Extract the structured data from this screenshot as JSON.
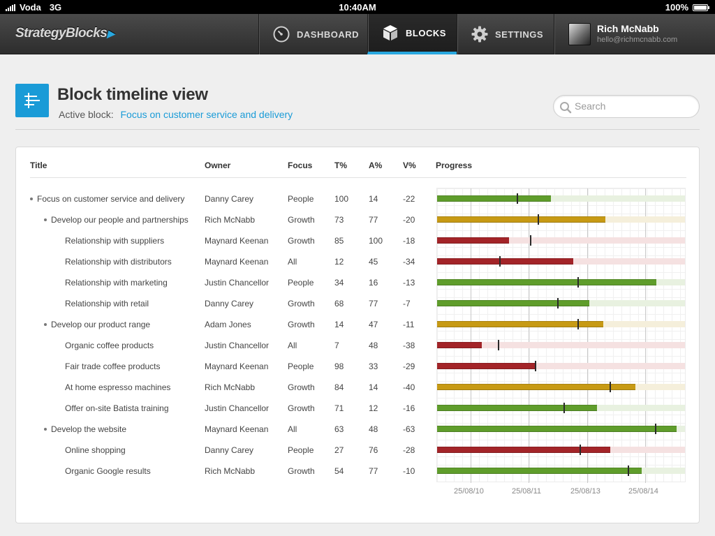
{
  "status": {
    "carrier": "Voda",
    "network": "3G",
    "time": "10:40AM",
    "battery": "100%"
  },
  "nav": {
    "logo": "StrategyBlocks",
    "items": [
      {
        "label": "DASHBOARD",
        "icon": "gauge-icon"
      },
      {
        "label": "BLOCKS",
        "icon": "cube-icon"
      },
      {
        "label": "SETTINGS",
        "icon": "gear-icon"
      }
    ],
    "active": "BLOCKS",
    "user": {
      "name": "Rich McNabb",
      "email": "hello@richmcnabb.com"
    }
  },
  "header": {
    "title": "Block timeline view",
    "active_label": "Active block:",
    "active_value": "Focus on customer service and delivery",
    "search_placeholder": "Search"
  },
  "table": {
    "columns": [
      "Title",
      "Owner",
      "Focus",
      "T%",
      "A%",
      "V%",
      "Progress"
    ],
    "status_colors": {
      "green": "#5f9d2b",
      "yellow": "#c79a14",
      "red": "#a32428"
    },
    "track_colors": {
      "green": "#e8f1e0",
      "yellow": "#f5efdb",
      "red": "#f5e1e1"
    },
    "rows": [
      {
        "title": "Focus on customer service and delivery",
        "level": 0,
        "owner": "Danny Carey",
        "focus": "People",
        "t": "100",
        "a": "14",
        "v": "-22",
        "status": "green",
        "progress": 0.46,
        "marker": 0.32
      },
      {
        "title": "Develop our people and partnerships",
        "level": 1,
        "owner": "Rich McNabb",
        "focus": "Growth",
        "t": "73",
        "a": "77",
        "v": "-20",
        "status": "yellow",
        "progress": 0.68,
        "marker": 0.405
      },
      {
        "title": "Relationship with suppliers",
        "level": 2,
        "owner": "Maynard Keenan",
        "focus": "Growth",
        "t": "85",
        "a": "100",
        "v": "-18",
        "status": "red",
        "progress": 0.29,
        "marker": 0.375
      },
      {
        "title": "Relationship with distributors",
        "level": 2,
        "owner": "Maynard Keenan",
        "focus": "All",
        "t": "12",
        "a": "45",
        "v": "-34",
        "status": "red",
        "progress": 0.55,
        "marker": 0.25
      },
      {
        "title": "Relationship with marketing",
        "level": 2,
        "owner": "Justin Chancellor",
        "focus": "People",
        "t": "34",
        "a": "16",
        "v": "-13",
        "status": "green",
        "progress": 0.885,
        "marker": 0.565
      },
      {
        "title": "Relationship with retail",
        "level": 2,
        "owner": "Danny Carey",
        "focus": "Growth",
        "t": "68",
        "a": "77",
        "v": "-7",
        "status": "green",
        "progress": 0.615,
        "marker": 0.485
      },
      {
        "title": "Develop our product range",
        "level": 1,
        "owner": "Adam Jones",
        "focus": "Growth",
        "t": "14",
        "a": "47",
        "v": "-11",
        "status": "yellow",
        "progress": 0.67,
        "marker": 0.565
      },
      {
        "title": "Organic coffee products",
        "level": 2,
        "owner": "Justin Chancellor",
        "focus": "All",
        "t": "7",
        "a": "48",
        "v": "-38",
        "status": "red",
        "progress": 0.18,
        "marker": 0.245
      },
      {
        "title": "Fair trade coffee products",
        "level": 2,
        "owner": "Maynard Keenan",
        "focus": "People",
        "t": "98",
        "a": "33",
        "v": "-29",
        "status": "red",
        "progress": 0.395,
        "marker": 0.395
      },
      {
        "title": "At home espresso machines",
        "level": 2,
        "owner": "Rich McNabb",
        "focus": "Growth",
        "t": "84",
        "a": "14",
        "v": "-40",
        "status": "yellow",
        "progress": 0.8,
        "marker": 0.695
      },
      {
        "title": "Offer on-site Batista training",
        "level": 2,
        "owner": "Justin Chancellor",
        "focus": "Growth",
        "t": "71",
        "a": "12",
        "v": "-16",
        "status": "green",
        "progress": 0.645,
        "marker": 0.51
      },
      {
        "title": "Develop the website",
        "level": 1,
        "owner": "Maynard Keenan",
        "focus": "All",
        "t": "63",
        "a": "48",
        "v": "-63",
        "status": "green",
        "progress": 0.965,
        "marker": 0.88
      },
      {
        "title": "Online shopping",
        "level": 2,
        "owner": "Danny Carey",
        "focus": "People",
        "t": "27",
        "a": "76",
        "v": "-28",
        "status": "red",
        "progress": 0.7,
        "marker": 0.575
      },
      {
        "title": "Organic Google results",
        "level": 2,
        "owner": "Rich McNabb",
        "focus": "Growth",
        "t": "54",
        "a": "77",
        "v": "-10",
        "status": "green",
        "progress": 0.825,
        "marker": 0.77
      }
    ],
    "timeline_ticks": [
      {
        "label": "25/08/10",
        "pos": 0.135
      },
      {
        "label": "25/08/11",
        "pos": 0.37
      },
      {
        "label": "25/08/13",
        "pos": 0.605
      },
      {
        "label": "25/08/14",
        "pos": 0.84
      }
    ]
  }
}
